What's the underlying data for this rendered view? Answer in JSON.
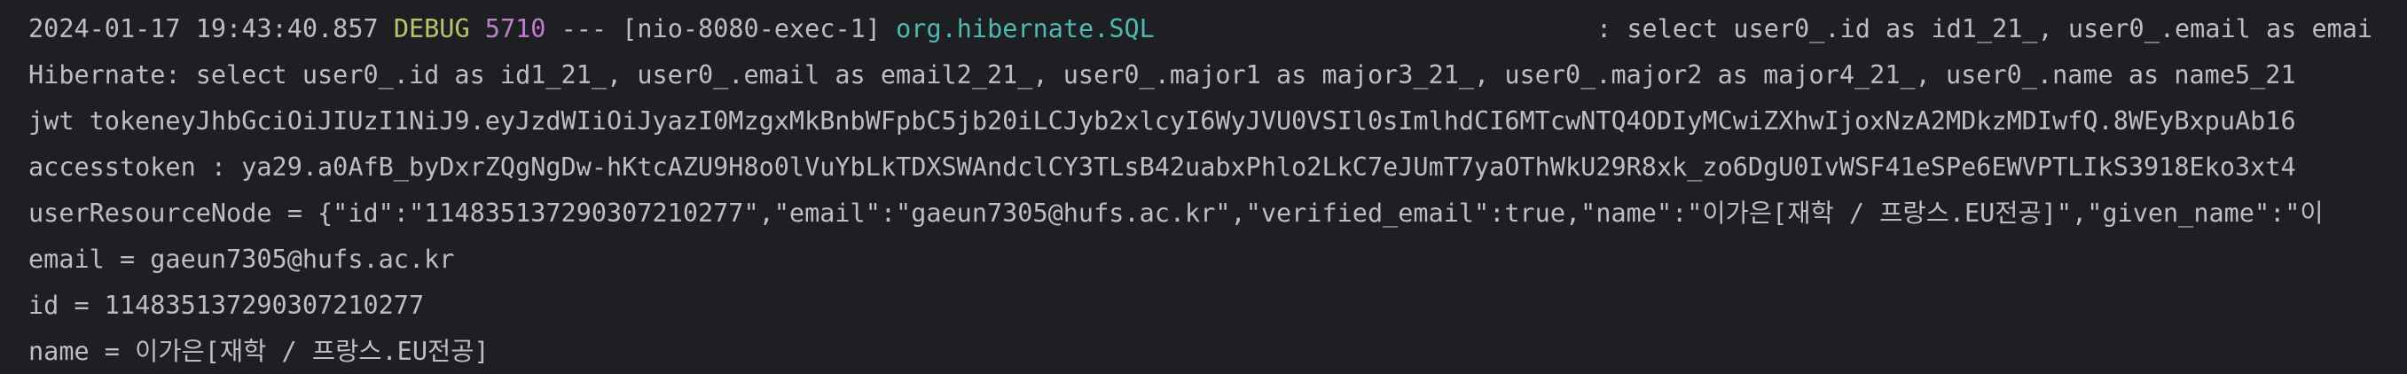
{
  "console": {
    "log_entry": {
      "timestamp": "2024-01-17 19:43:40.857",
      "level": "DEBUG",
      "pid": "5710",
      "separator": "---",
      "thread": "[nio-8080-exec-1]",
      "logger": "org.hibernate.SQL",
      "message": ": select user0_.id as id1_21_, user0_.email as emai"
    },
    "lines": [
      "Hibernate: select user0_.id as id1_21_, user0_.email as email2_21_, user0_.major1 as major3_21_, user0_.major2 as major4_21_, user0_.name as name5_21",
      "jwt tokeneyJhbGciOiJIUzI1NiJ9.eyJzdWIiOiJyazI0MzgxMkBnbWFpbC5jb20iLCJyb2xlcyI6WyJVU0VSIl0sImlhdCI6MTcwNTQ4ODIyMCwiZXhwIjoxNzA2MDkzMDIwfQ.8WEyBxpuAb16",
      "accesstoken : ya29.a0AfB_byDxrZQgNgDw-hKtcAZU9H8o0lVuYbLkTDXSWAndclCY3TLsB42uabxPhlo2LkC7eJUmT7yaOThWkU29R8xk_zo6DgU0IvWSF41eSPe6EWVPTLIkS3918Eko3xt4",
      "userResourceNode = {\"id\":\"114835137290307210277\",\"email\":\"gaeun7305@hufs.ac.kr\",\"verified_email\":true,\"name\":\"이가은[재학 / 프랑스.EU전공]\",\"given_name\":\"이",
      "email = gaeun7305@hufs.ac.kr",
      "id = 114835137290307210277",
      "name = 이가은[재학 / 프랑스.EU전공]"
    ]
  }
}
